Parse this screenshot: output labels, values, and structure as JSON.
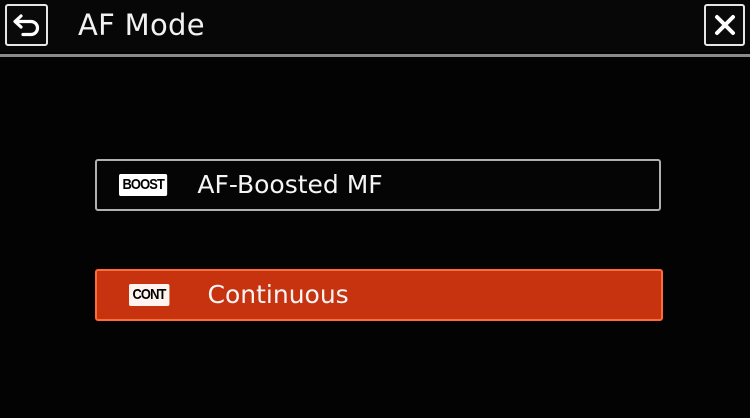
{
  "header": {
    "title": "AF Mode",
    "back_icon": "return-arrow-icon",
    "close_icon": "close-x-icon"
  },
  "options": [
    {
      "badge": "BOOST",
      "label": "AF-Boosted MF",
      "selected": false
    },
    {
      "badge": "CONT",
      "label": "Continuous",
      "selected": true
    }
  ],
  "colors": {
    "background": "#030303",
    "selected_fill": "#c8330f",
    "selected_border": "#ff6a3a",
    "unselected_border": "#b0b0b0",
    "divider": "#8a8a8a"
  }
}
